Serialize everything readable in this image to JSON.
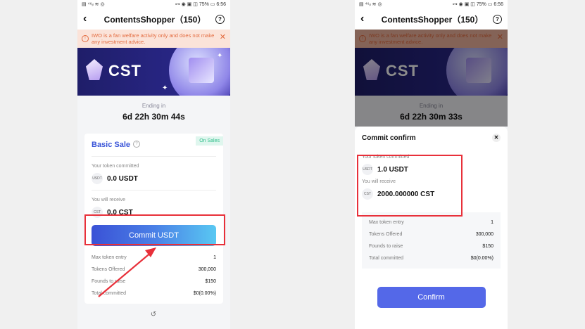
{
  "status": {
    "left": "▤ ⁴⁶ᵢₗ ≋ ◎",
    "right": "⊶ ◉ ▣ ◫ 75% ▭ 6:56"
  },
  "nav": {
    "title": "ContentsShopper（150）",
    "back": "‹",
    "help": "?"
  },
  "notice": {
    "text": "IWO is a fan welfare activity only and does not make any investment advice.",
    "close": "✕"
  },
  "banner": {
    "brand": "CST"
  },
  "screen1": {
    "ending_label": "Ending in",
    "ending_time": "6d 22h 30m 44s",
    "sale_title": "Basic Sale",
    "sale_badge": "On Sales",
    "committed_label": "Your token committed",
    "committed_token": "USDT",
    "committed_value": "0.0 USDT",
    "receive_label": "You will receive",
    "receive_token": "CST",
    "receive_value": "0.0 CST",
    "commit_button": "Commit USDT",
    "rows": [
      {
        "label": "Max token entry",
        "value": "1"
      },
      {
        "label": "Tokens Offered",
        "value": "300,000"
      },
      {
        "label": "Founds to raise",
        "value": "$150"
      },
      {
        "label": "Total committed",
        "value": "$0(0.00%)"
      }
    ]
  },
  "screen2": {
    "ending_label": "Ending in",
    "ending_time": "6d 22h 30m 33s",
    "sheet_title": "Commit confirm",
    "close": "✕",
    "committed_label": "Your token committed",
    "committed_token": "USDT",
    "committed_value": "1.0 USDT",
    "receive_label": "You will receive",
    "receive_token": "CST",
    "receive_value": "2000.000000 CST",
    "rows": [
      {
        "label": "Max token entry",
        "value": "1"
      },
      {
        "label": "Tokens Offered",
        "value": "300,000"
      },
      {
        "label": "Founds to raise",
        "value": "$150"
      },
      {
        "label": "Total committed",
        "value": "$0(0.00%)"
      }
    ],
    "confirm_button": "Confirm"
  },
  "colors": {
    "accent": "#3a55d8",
    "highlight": "#e8303a",
    "badge": "#2fbf8a",
    "warn": "#e36b3f"
  }
}
